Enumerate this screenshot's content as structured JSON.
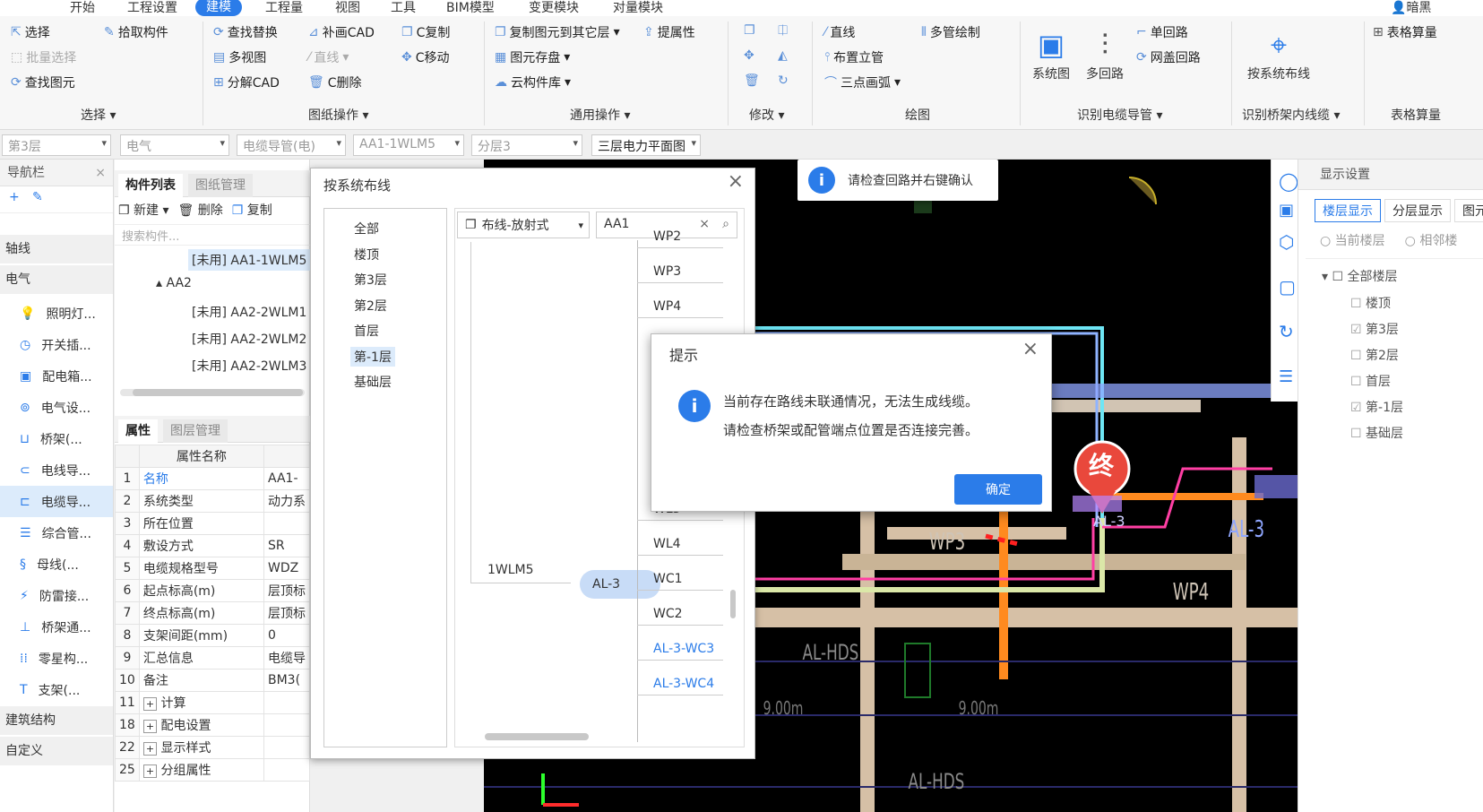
{
  "menu": [
    "开始",
    "工程设置",
    "建模",
    "工程量",
    "视图",
    "工具",
    "BIM模型",
    "变更模块",
    "对量模块"
  ],
  "menu_active_index": 2,
  "user_label": "暗黑",
  "ribbon": {
    "select": {
      "select": "选择",
      "batch_select": "批量选择",
      "find_element": "查找图元",
      "pick_component": "拾取构件",
      "group": "选择"
    },
    "drawing": {
      "find_replace": "查找替换",
      "multi_view": "多视图",
      "explode_cad": "分解CAD",
      "patch_cad": "补画CAD",
      "line": "直线",
      "c_copy": "C复制",
      "c_move": "C移动",
      "c_delete": "C删除",
      "group": "图纸操作"
    },
    "general": {
      "copy_to_layer": "复制图元到其它层",
      "extract_attr": "提属性",
      "storage": "图元存盘",
      "cloud_lib": "云构件库",
      "group": "通用操作"
    },
    "modify": {
      "group": "修改"
    },
    "draw": {
      "line": "直线",
      "multi_pipe": "多管绘制",
      "riser": "布置立管",
      "arc": "三点画弧",
      "group": "绘图"
    },
    "identify": {
      "system_diagram": "系统图",
      "multi_circuit": "多回路",
      "single_circuit": "单回路",
      "box_circuit": "网盖回路",
      "group": "识别电缆导管"
    },
    "tray": {
      "route_by_system": "按系统布线",
      "group": "识别桥架内线缆"
    },
    "table": {
      "table_calc": "表格算量",
      "group": "表格算量"
    }
  },
  "filters": [
    "第3层",
    "电气",
    "电缆导管(电)",
    "AA1-1WLM5",
    "分层3",
    "三层电力平面图"
  ],
  "nav": {
    "title": "导航栏",
    "categories": [
      "轴线",
      "电气",
      "建筑结构",
      "自定义"
    ],
    "items": [
      "照明灯...",
      "开关插...",
      "配电箱...",
      "电气设...",
      "桥架(...",
      "电线导...",
      "电缆导...",
      "综合管...",
      "母线(...",
      "防雷接...",
      "桥架通...",
      "零星构...",
      "支架(..."
    ]
  },
  "comp": {
    "tabs": [
      "构件列表",
      "图纸管理"
    ],
    "toolbar": {
      "new": "新建",
      "delete": "删除",
      "copy": "复制"
    },
    "search_placeholder": "搜索构件...",
    "tree": [
      "[未用] AA1-1WLM5",
      "AA2",
      "[未用] AA2-2WLM1",
      "[未用] AA2-2WLM2",
      "[未用] AA2-2WLM3"
    ],
    "prop_tabs": [
      "属性",
      "图层管理"
    ],
    "prop_header": "属性名称",
    "props": [
      {
        "n": "1",
        "k": "名称",
        "v": "AA1-"
      },
      {
        "n": "2",
        "k": "系统类型",
        "v": "动力系"
      },
      {
        "n": "3",
        "k": "所在位置",
        "v": ""
      },
      {
        "n": "4",
        "k": "敷设方式",
        "v": "SR"
      },
      {
        "n": "5",
        "k": "电缆规格型号",
        "v": "WDZ"
      },
      {
        "n": "6",
        "k": "起点标高(m)",
        "v": "层顶标"
      },
      {
        "n": "7",
        "k": "终点标高(m)",
        "v": "层顶标"
      },
      {
        "n": "8",
        "k": "支架间距(mm)",
        "v": "0"
      },
      {
        "n": "9",
        "k": "汇总信息",
        "v": "电缆导"
      },
      {
        "n": "10",
        "k": "备注",
        "v": "BM3("
      },
      {
        "n": "11",
        "k": "计算",
        "v": ""
      },
      {
        "n": "18",
        "k": "配电设置",
        "v": ""
      },
      {
        "n": "22",
        "k": "显示样式",
        "v": ""
      },
      {
        "n": "25",
        "k": "分组属性",
        "v": ""
      }
    ]
  },
  "route_dialog": {
    "title": "按系统布线",
    "levels": [
      "全部",
      "楼顶",
      "第3层",
      "第2层",
      "首层",
      "第-1层",
      "基础层"
    ],
    "selected_level": "第-1层",
    "mode": "布线-放射式",
    "search_value": "AA1",
    "node_left": "1WLM5",
    "node_box": "AL-3",
    "circuits": [
      "WP2",
      "WP3",
      "WP4",
      "WL3",
      "WL4",
      "WC1",
      "WC2",
      "AL-3-WC3",
      "AL-3-WC4"
    ]
  },
  "hint_dialog": {
    "title": "提示",
    "line1": "当前存在路线未联通情况，无法生成线缆。",
    "line2": "请检查桥架或配管端点位置是否连接完善。",
    "ok": "确定"
  },
  "toast": "请检查回路并右键确认",
  "canvas_labels": {
    "end_marker": "终",
    "wp3": "WP3",
    "wp4": "WP4",
    "al3": "AL-3",
    "al3b": "AL-3",
    "alhds": "AL-HDS",
    "alhds2": "AL-HDS",
    "h1": "9.00m",
    "h2": "9.00m"
  },
  "right": {
    "title": "显示设置",
    "tabs": [
      "楼层显示",
      "分层显示",
      "图元"
    ],
    "radios": [
      "当前楼层",
      "相邻楼"
    ],
    "all_floors": "全部楼层",
    "floors": [
      {
        "name": "楼顶",
        "checked": false
      },
      {
        "name": "第3层",
        "checked": true
      },
      {
        "name": "第2层",
        "checked": false
      },
      {
        "name": "首层",
        "checked": false
      },
      {
        "name": "第-1层",
        "checked": true
      },
      {
        "name": "基础层",
        "checked": false
      }
    ]
  },
  "colors": {
    "accent": "#2b7ce9",
    "pink": "#ff3fa4",
    "cyan": "#6ee6f5",
    "tan": "#d6c0a6"
  }
}
